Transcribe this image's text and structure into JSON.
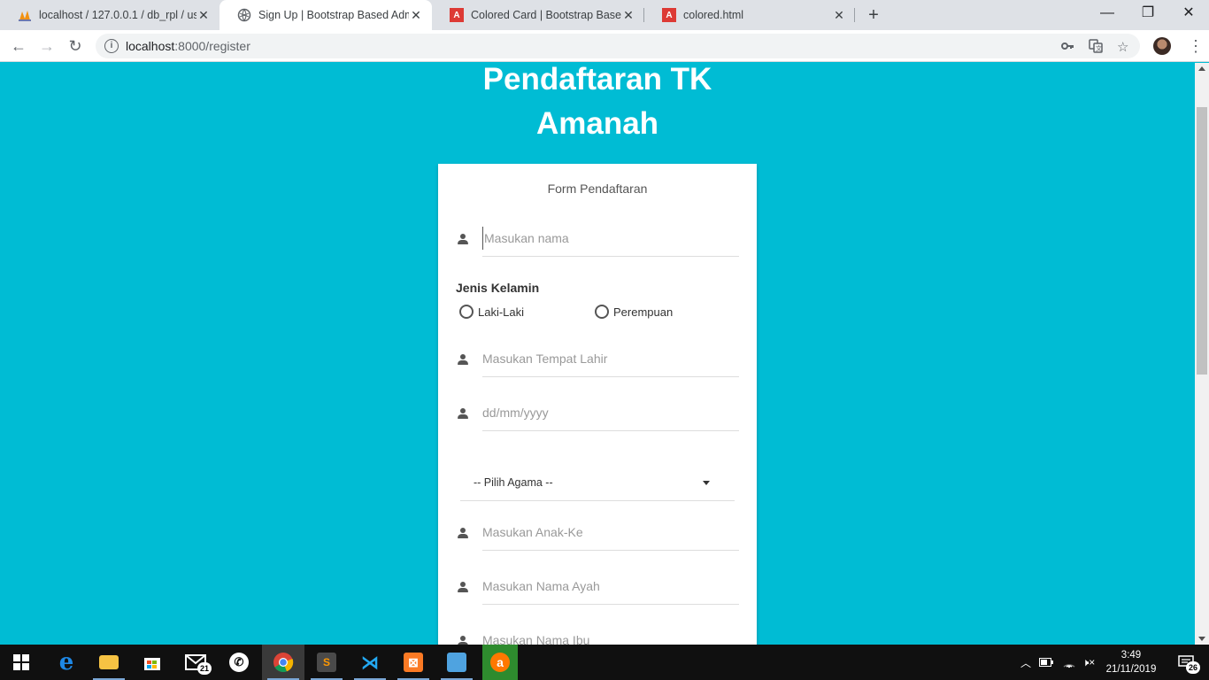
{
  "browser": {
    "tabs": [
      {
        "title": "localhost / 127.0.0.1 / db_rpl / us",
        "favicon": "phpmyadmin-icon",
        "active": false
      },
      {
        "title": "Sign Up | Bootstrap Based Admin",
        "favicon": "globe-icon",
        "active": true
      },
      {
        "title": "Colored Card | Bootstrap Based A",
        "favicon": "angular-icon",
        "active": false
      },
      {
        "title": "colored.html",
        "favicon": "angular-icon",
        "active": false
      }
    ],
    "url_host": "localhost",
    "url_path": ":8000/register"
  },
  "page": {
    "title_line1": "Pendaftaran TK",
    "title_line2": "Amanah",
    "card_title": "Form Pendaftaran",
    "name_placeholder": "Masukan nama",
    "gender_label": "Jenis Kelamin",
    "gender_options": [
      "Laki-Laki",
      "Perempuan"
    ],
    "birthplace_placeholder": "Masukan Tempat Lahir",
    "birthdate_placeholder": "dd/mm/yyyy",
    "religion_selected": "-- Pilih Agama --",
    "child_order_placeholder": "Masukan Anak-Ke",
    "father_placeholder": "Masukan Nama Ayah",
    "mother_placeholder": "Masukan Nama Ibu"
  },
  "taskbar": {
    "mail_badge": "21",
    "notification_badge": "26",
    "time": "3:49",
    "date": "21/11/2019"
  },
  "colors": {
    "page_background": "#00bcd4",
    "card_background": "#ffffff"
  }
}
